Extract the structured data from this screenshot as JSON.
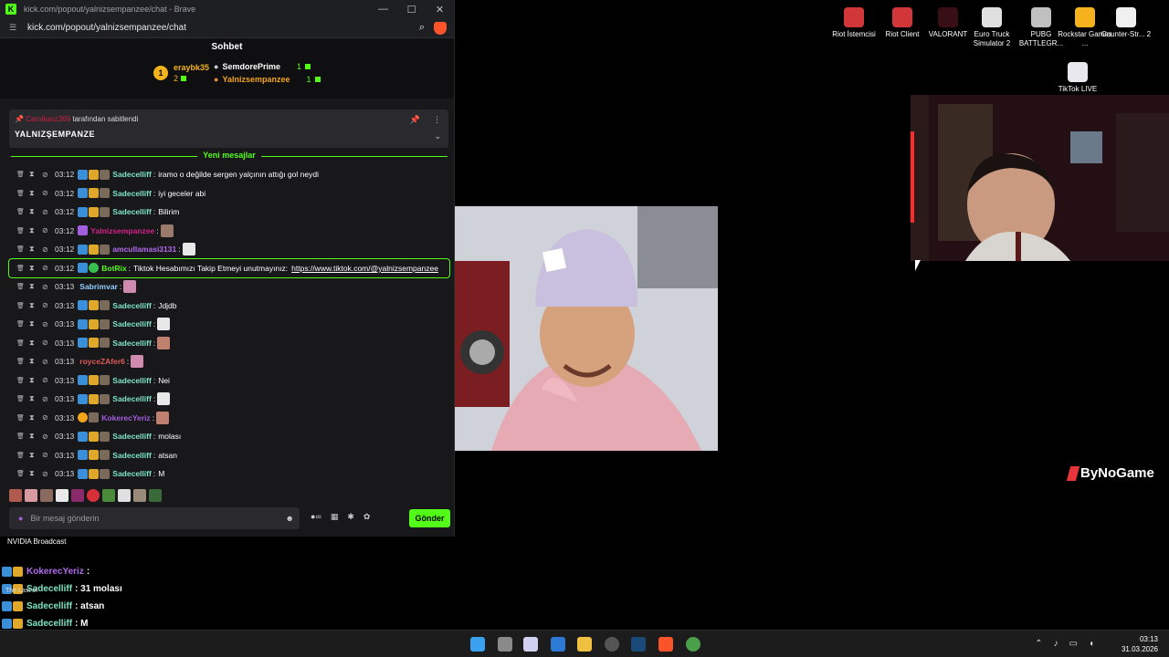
{
  "window": {
    "title": "kick.com/popout/yalnizsempanzee/chat - Brave",
    "url": "kick.com/popout/yalnizsempanzee/chat",
    "controls": [
      "—",
      "☐",
      "✕"
    ]
  },
  "chat": {
    "header": "Sohbet",
    "leaderboard": {
      "first": {
        "rank": "1",
        "name": "eraybk35",
        "count": "2"
      },
      "second": {
        "name": "SemdorePrime",
        "count": "1"
      },
      "third": {
        "name": "Yalnizsempanzee",
        "count": "1"
      }
    },
    "pinned": {
      "pinned_by_user": "Carolkasz369",
      "pinned_by_suffix": "tarafından sabitlendi",
      "text": "YALNIZŞEMPANZE"
    },
    "new_messages_label": "Yeni mesajlar",
    "messages": [
      {
        "time": "03:12",
        "user": "Sadecelliff",
        "color": "#7ee6c4",
        "badges": [
          "blue",
          "gold",
          "gray"
        ],
        "text": "iramo o değilde sergen yalçının attığı gol neydi"
      },
      {
        "time": "03:12",
        "user": "Sadecelliff",
        "color": "#7ee6c4",
        "badges": [
          "blue",
          "gold",
          "gray"
        ],
        "text": "iyi geceler abi"
      },
      {
        "time": "03:12",
        "user": "Sadecelliff",
        "color": "#7ee6c4",
        "badges": [
          "blue",
          "gold",
          "gray"
        ],
        "text": "Bilirim"
      },
      {
        "time": "03:12",
        "user": "Yalnizsempanzee",
        "color": "#d6208a",
        "badges": [
          "purple"
        ],
        "text": ""
      },
      {
        "time": "03:12",
        "user": "amcullamasi3131",
        "color": "#b36bf0",
        "badges": [
          "blue",
          "gold",
          "gray"
        ],
        "text": ""
      },
      {
        "time": "03:12",
        "user": "BotRix",
        "color": "#53fc18",
        "badges": [
          "blue",
          "green"
        ],
        "text": "Tiktok Hesabımızı Takip Etmeyi unutmayınız:",
        "link": "https://www.tiktok.com/@yalnizsempanzee",
        "highlight": true
      },
      {
        "time": "03:13",
        "user": "Sabrimvar",
        "color": "#8fd0ff",
        "badges": [],
        "text": ""
      },
      {
        "time": "03:13",
        "user": "Sadecelliff",
        "color": "#7ee6c4",
        "badges": [
          "blue",
          "gold",
          "gray"
        ],
        "text": "Jdjdb"
      },
      {
        "time": "03:13",
        "user": "Sadecelliff",
        "color": "#7ee6c4",
        "badges": [
          "blue",
          "gold",
          "gray"
        ],
        "text": ""
      },
      {
        "time": "03:13",
        "user": "Sadecelliff",
        "color": "#7ee6c4",
        "badges": [
          "blue",
          "gold",
          "gray"
        ],
        "text": ""
      },
      {
        "time": "03:13",
        "user": "royceZAfer6",
        "color": "#e05a5a",
        "badges": [],
        "text": ""
      },
      {
        "time": "03:13",
        "user": "Sadecelliff",
        "color": "#7ee6c4",
        "badges": [
          "blue",
          "gold",
          "gray"
        ],
        "text": "Nei"
      },
      {
        "time": "03:13",
        "user": "Sadecelliff",
        "color": "#7ee6c4",
        "badges": [
          "blue",
          "gold",
          "gray"
        ],
        "text": ""
      },
      {
        "time": "03:13",
        "user": "KokerecYeriz",
        "color": "#a35ddf",
        "badges": [
          "orange",
          "gray"
        ],
        "text": ""
      },
      {
        "time": "03:13",
        "user": "Sadecelliff",
        "color": "#7ee6c4",
        "badges": [
          "blue",
          "gold",
          "gray"
        ],
        "text": "molası"
      },
      {
        "time": "03:13",
        "user": "Sadecelliff",
        "color": "#7ee6c4",
        "badges": [
          "blue",
          "gold",
          "gray"
        ],
        "text": "atsan"
      },
      {
        "time": "03:13",
        "user": "Sadecelliff",
        "color": "#7ee6c4",
        "badges": [
          "blue",
          "gold",
          "gray"
        ],
        "text": "M"
      }
    ],
    "input_placeholder": "Bir mesaj gönderin",
    "send_label": "Gönder"
  },
  "desktop_icons": [
    {
      "label": "Riot İstemcisi",
      "color": "#d13639"
    },
    {
      "label": "Riot Client",
      "color": "#d13639"
    },
    {
      "label": "VALORANT",
      "color": "#3a0e16"
    },
    {
      "label": "Euro Truck Simulator 2",
      "color": "#e0e0e0"
    },
    {
      "label": "PUBG BATTLEGR...",
      "color": "#c0c0c0"
    },
    {
      "label": "Rockstar Games ...",
      "color": "#f5b21c"
    },
    {
      "label": "Counter-Str... 2",
      "color": "#f0f0f0"
    }
  ],
  "tiktok_icon_label": "TikTok LIVE",
  "brand_overlay": "ByNoGame",
  "nvidia_label": "NVIDIA Broadcast",
  "thelast_label": "The Last of",
  "overlay_chat": [
    {
      "user": "KokerecYeriz",
      "color": "#b36bf0",
      "text": ":"
    },
    {
      "user": "Sadecelliff",
      "color": "#7ee6c4",
      "text": ": 31 molası"
    },
    {
      "user": "Sadecelliff",
      "color": "#7ee6c4",
      "text": ": atsan"
    },
    {
      "user": "Sadecelliff",
      "color": "#7ee6c4",
      "text": ": M"
    }
  ],
  "clock": {
    "time": "03:13",
    "date": "31.03.2026"
  }
}
